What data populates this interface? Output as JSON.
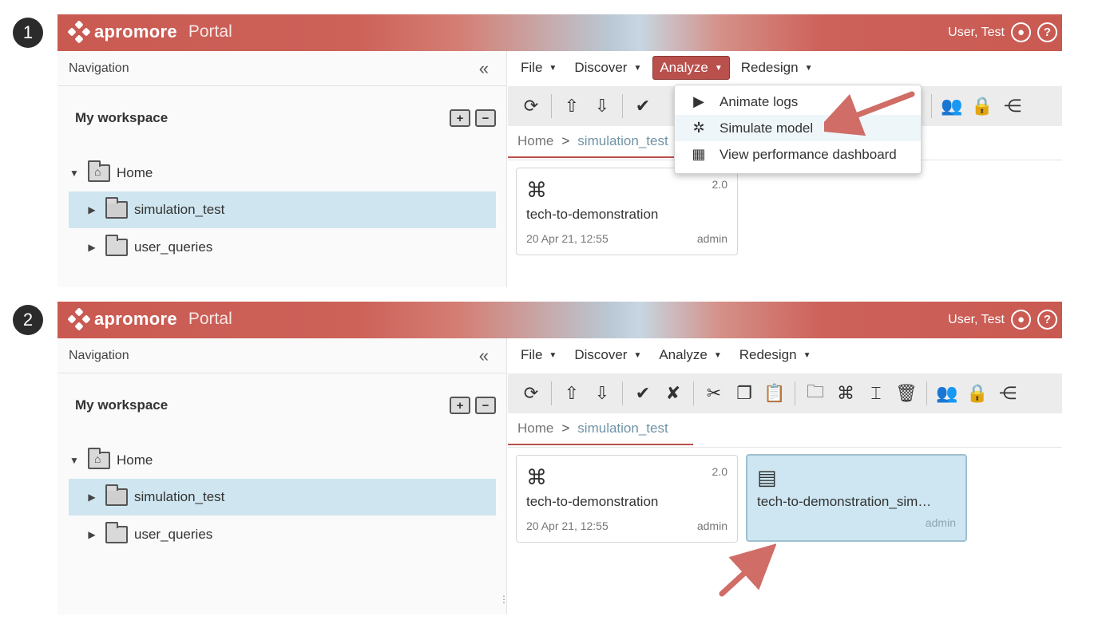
{
  "badges": [
    "1",
    "2"
  ],
  "header": {
    "logo_text": "apromore",
    "portal": "Portal",
    "user": "User, Test",
    "user_icon": "user-circle-icon",
    "help_icon": "help-circle-icon"
  },
  "nav": {
    "title": "Navigation",
    "collapse": "«",
    "workspace": "My workspace",
    "add_folder": "+",
    "remove_folder": "−"
  },
  "tree": {
    "home": "Home",
    "simulation_test": "simulation_test",
    "user_queries": "user_queries"
  },
  "menus": {
    "file": "File",
    "discover": "Discover",
    "analyze": "Analyze",
    "redesign": "Redesign"
  },
  "breadcrumb": {
    "home": "Home",
    "separator": ">",
    "current": "simulation_test"
  },
  "dropdown": {
    "animate": "Animate logs",
    "simulate": "Simulate model",
    "dashboard": "View performance dashboard"
  },
  "cards": {
    "model": {
      "version": "2.0",
      "name": "tech-to-demonstration",
      "date": "20 Apr 21, 12:55",
      "owner": "admin"
    },
    "sim": {
      "name": "tech-to-demonstration_sim…",
      "owner": "admin"
    }
  },
  "toolbar_icons": [
    "refresh-icon",
    "upload-icon",
    "download-icon",
    "check-icon",
    "uncheck-icon",
    "cut-icon",
    "copy-icon",
    "paste-icon",
    "new-folder-icon",
    "new-model-icon",
    "edit-icon",
    "delete-icon",
    "users-icon",
    "user-lock-icon",
    "share-icon"
  ],
  "colors": {
    "header": "#c95a52",
    "accent": "#b9504c",
    "selection": "#cfe6f0"
  }
}
